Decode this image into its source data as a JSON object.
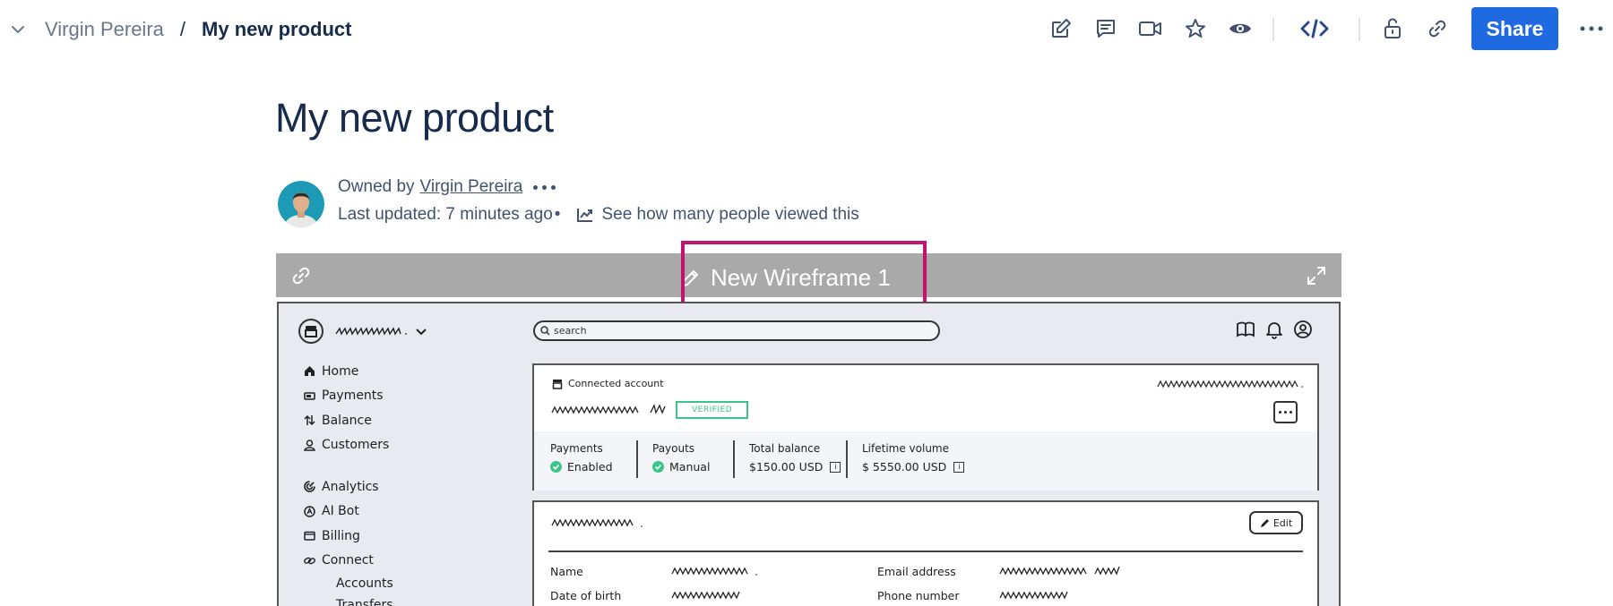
{
  "breadcrumb": {
    "space": "Virgin Pereira",
    "separator": "/",
    "page": "My new product"
  },
  "toolbar": {
    "icons": [
      "edit-icon",
      "comment-icon",
      "video-icon",
      "star-icon",
      "watch-icon",
      "embed-code-icon",
      "unlock-icon",
      "link-icon",
      "more-icon"
    ],
    "share_label": "Share",
    "accent": "#1f6ae0"
  },
  "page": {
    "title": "My new product",
    "owned_by": "Owned by",
    "owner": "Virgin Pereira",
    "last_updated": "Last updated: 7 minutes ago",
    "bullet": "•",
    "views_link": "See how many people viewed this"
  },
  "embed": {
    "title": "New Wireframe 1",
    "highlight_color": "#c0146e",
    "wireframe": {
      "search_placeholder": "search",
      "nav": {
        "home": "Home",
        "payments": "Payments",
        "balance": "Balance",
        "customers": "Customers",
        "analytics": "Analytics",
        "ai_bot": "AI Bot",
        "billing": "Billing",
        "connect": "Connect",
        "accounts": "Accounts",
        "transfers": "Transfers"
      },
      "account_card": {
        "connected": "Connected account",
        "verified": "VERIFIED",
        "stats": [
          {
            "label": "Payments",
            "value": "Enabled"
          },
          {
            "label": "Payouts",
            "value": "Manual"
          },
          {
            "label": "Total balance",
            "value": "$150.00 USD"
          },
          {
            "label": "Lifetime volume",
            "value": "$ 5550.00 USD"
          }
        ],
        "info_glyph": "i"
      },
      "details_card": {
        "edit_label": "Edit",
        "fields": [
          "Name",
          "Date of birth",
          "Email address",
          "Phone number"
        ]
      }
    }
  }
}
